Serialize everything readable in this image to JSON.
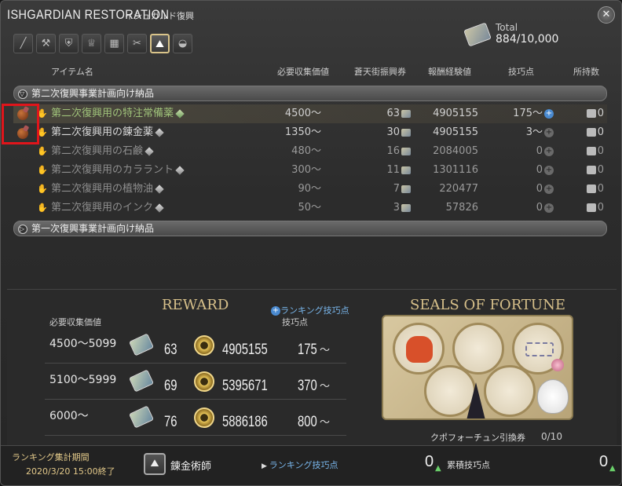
{
  "window": {
    "title_en": "ISHGARDIAN RESTORATION",
    "title_jp": "イシュガルド復興"
  },
  "total": {
    "label": "Total",
    "value": "884/10,000"
  },
  "icons": [
    "sword-icon",
    "anvil-icon",
    "helmet-icon",
    "crown-icon",
    "loom-icon",
    "leaf-icon",
    "alchemy-icon",
    "cooking-icon"
  ],
  "headers": {
    "item": "アイテム名",
    "collect": "必要収集価値",
    "scrip": "蒼天街振興券",
    "exp": "報酬経験値",
    "skill": "技巧点",
    "owned": "所持数"
  },
  "group2": "第二次復興事業計画向け納品",
  "group1": "第一次復興事業計画向け納品",
  "items": [
    {
      "name": "第二次復興用の特注常備薬",
      "collect": "4500〜",
      "scrip": "63",
      "exp": "4905155",
      "skill": "175〜",
      "owned": "0"
    },
    {
      "name": "第二次復興用の錬金薬",
      "collect": "1350〜",
      "scrip": "30",
      "exp": "4905155",
      "skill": "3〜",
      "owned": "0"
    },
    {
      "name": "第二次復興用の石鹸",
      "collect": "480〜",
      "scrip": "16",
      "exp": "2084005",
      "skill": "0",
      "owned": "0"
    },
    {
      "name": "第二次復興用のカララント",
      "collect": "300〜",
      "scrip": "11",
      "exp": "1301116",
      "skill": "0",
      "owned": "0"
    },
    {
      "name": "第二次復興用の植物油",
      "collect": "90〜",
      "scrip": "7",
      "exp": "220477",
      "skill": "0",
      "owned": "0"
    },
    {
      "name": "第二次復興用のインク",
      "collect": "50〜",
      "scrip": "3",
      "exp": "57826",
      "skill": "0",
      "owned": "0"
    }
  ],
  "reward": {
    "title": "REWARD",
    "header_collect": "必要収集価値",
    "rank_link": "ランキング技巧点",
    "rank_sub": "技巧点",
    "rows": [
      {
        "range": "4500〜5099",
        "scrip": "63",
        "exp": "4905155",
        "skill": "175",
        "tilde": "〜"
      },
      {
        "range": "5100〜5999",
        "scrip": "69",
        "exp": "5395671",
        "skill": "370",
        "tilde": "〜"
      },
      {
        "range": "6000〜",
        "scrip": "76",
        "exp": "5886186",
        "skill": "800",
        "tilde": "〜"
      }
    ]
  },
  "seals": {
    "title": "SEALS OF FORTUNE",
    "label": "クポフォーチュン引換券",
    "value": "0/10"
  },
  "footer": {
    "period_label": "ランキング集計期間",
    "period_end": "2020/3/20 15:00終了",
    "job": "錬金術師",
    "rank_label": "ランキング技巧点",
    "rank_value": "0",
    "cum_label": "累積技巧点",
    "cum_value": "0"
  }
}
